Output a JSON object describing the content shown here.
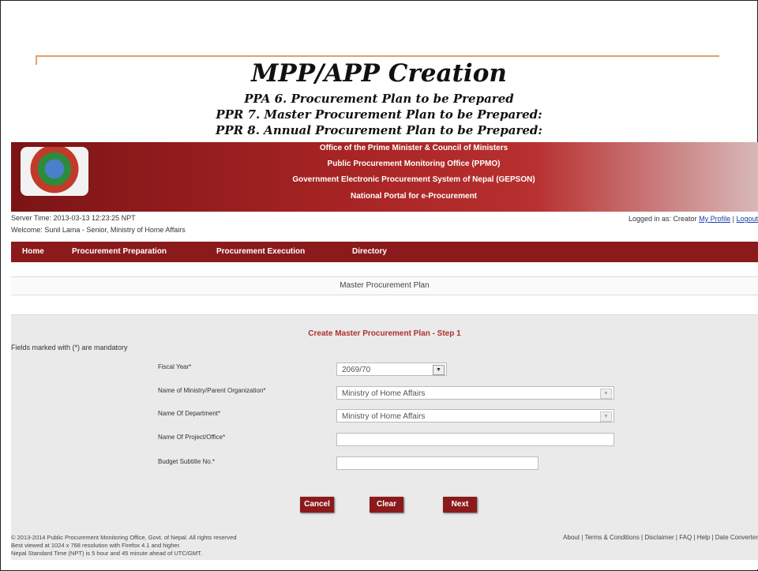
{
  "slide": {
    "title": "MPP/APP Creation",
    "subtitles": [
      "PPA  6. Procurement Plan to be Prepared",
      "PPR  7. Master Procurement Plan to be Prepared:",
      "PPR  8. Annual Procurement Plan to be Prepared:"
    ]
  },
  "banner": {
    "lines": [
      "Office of the Prime Minister & Council of Ministers",
      "Public Procurement Monitoring Office (PPMO)",
      "Government Electronic Procurement System of Nepal (GEPSON)",
      "National Portal for e-Procurement"
    ]
  },
  "header": {
    "server_time": "Server Time: 2013-03-13 12:23:25 NPT",
    "welcome": "Welcome: Sunil Lama - Senior, Ministry of Home Affairs",
    "logged_in": "Logged in as: Creator",
    "my_profile": "My Profile",
    "separator": "|",
    "logout": "Logout"
  },
  "nav": {
    "items": [
      "Home",
      "Procurement Preparation",
      "Procurement Execution",
      "Directory"
    ]
  },
  "panel": {
    "title": "Master Procurement Plan",
    "step_title": "Create Master Procurement Plan - Step 1",
    "mandatory_note": "Fields marked with (*) are mandatory"
  },
  "form": {
    "fiscal_year": {
      "label": "Fiscal Year*",
      "value": "2069/70"
    },
    "ministry": {
      "label": "Name of Ministry/Parent Organization*",
      "value": "Ministry of Home Affairs"
    },
    "department": {
      "label": "Name Of Department*",
      "value": "Ministry of Home Affairs"
    },
    "project": {
      "label": "Name Of Project/Office*",
      "value": ""
    },
    "budget": {
      "label": "Budget Subtitle No.*",
      "value": ""
    }
  },
  "buttons": {
    "cancel": "Cancel",
    "clear": "Clear",
    "next": "Next"
  },
  "footer": {
    "line1": "© 2013-2014 Public Procurement Monitoring Office, Govt. of Nepal. All rights reserved",
    "line2": "Best viewed at 1024 x 768 resolution with Firefox 4.1 and higher.",
    "line3": "Nepal Standard Time (NPT) is 5 hour and 45 minute ahead of UTC/GMT.",
    "links": [
      "About",
      "Terms & Conditions",
      "Disclaimer",
      "FAQ",
      "Help",
      "Date Converter"
    ]
  },
  "colors": {
    "brand": "#8b1a1c",
    "accent_line": "#e2a06a",
    "step_title": "#b03030"
  }
}
